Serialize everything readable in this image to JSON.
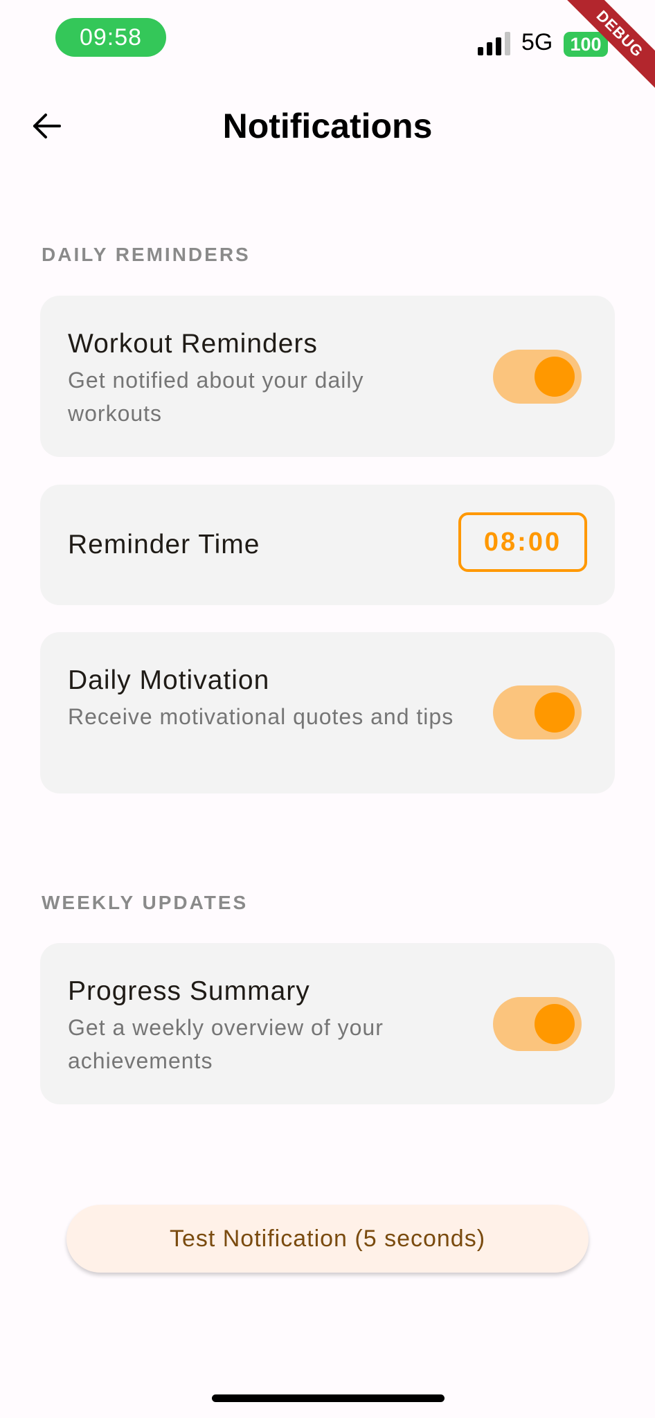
{
  "status_bar": {
    "time": "09:58",
    "network": "5G",
    "battery": "100",
    "debug_banner": "DEBUG"
  },
  "header": {
    "title": "Notifications"
  },
  "sections": {
    "daily": {
      "header": "DAILY REMINDERS",
      "workout": {
        "title": "Workout Reminders",
        "subtitle": "Get notified about your daily workouts",
        "enabled": true
      },
      "reminder_time": {
        "title": "Reminder Time",
        "value": "08:00"
      },
      "motivation": {
        "title": "Daily Motivation",
        "subtitle": "Receive motivational quotes and tips",
        "enabled": true
      }
    },
    "weekly": {
      "header": "WEEKLY UPDATES",
      "progress": {
        "title": "Progress Summary",
        "subtitle": "Get a weekly overview of your achievements",
        "enabled": true
      }
    }
  },
  "test_button": {
    "label": "Test Notification (5 seconds)"
  },
  "colors": {
    "accent": "#ff9800",
    "toggle_track": "#fbc47d",
    "status_green": "#34c759",
    "card_bg": "#f3f3f3"
  },
  "icons": {
    "back": "arrow-left-icon",
    "signal": "cellular-signal-icon"
  }
}
